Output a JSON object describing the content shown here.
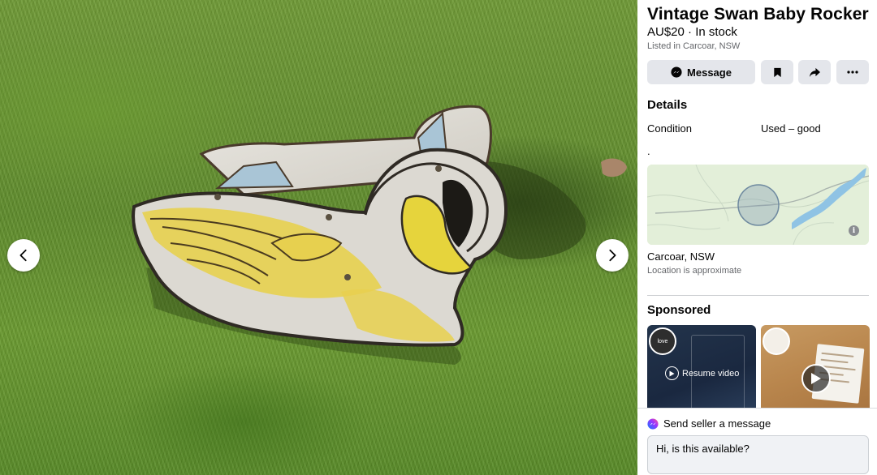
{
  "listing": {
    "title": "Vintage Swan Baby Rocker",
    "price_status": "AU$20 · In stock",
    "location_line": "Listed in Carcoar, NSW"
  },
  "actions": {
    "message_label": "Message"
  },
  "details": {
    "heading": "Details",
    "condition_label": "Condition",
    "condition_value": "Used – good",
    "description": "."
  },
  "map": {
    "place": "Carcoar, NSW",
    "approx_note": "Location is approximate",
    "info_glyph": "i"
  },
  "sponsored": {
    "heading": "Sponsored",
    "ads": [
      {
        "logo_text": "love",
        "overlay_label": "Resume video"
      },
      {
        "logo_text": ""
      }
    ]
  },
  "composer": {
    "title": "Send seller a message",
    "message_value": "Hi, is this available?"
  },
  "icons": {
    "prev": "chevron-left-icon",
    "next": "chevron-right-icon",
    "message": "messenger-icon",
    "save": "bookmark-icon",
    "share": "share-arrow-icon",
    "more": "more-dots-icon"
  },
  "colors": {
    "grass": "#6a9a30",
    "button_bg": "#e4e6eb",
    "secondary_text": "#65676b",
    "messenger_purple": "#a033ff"
  }
}
